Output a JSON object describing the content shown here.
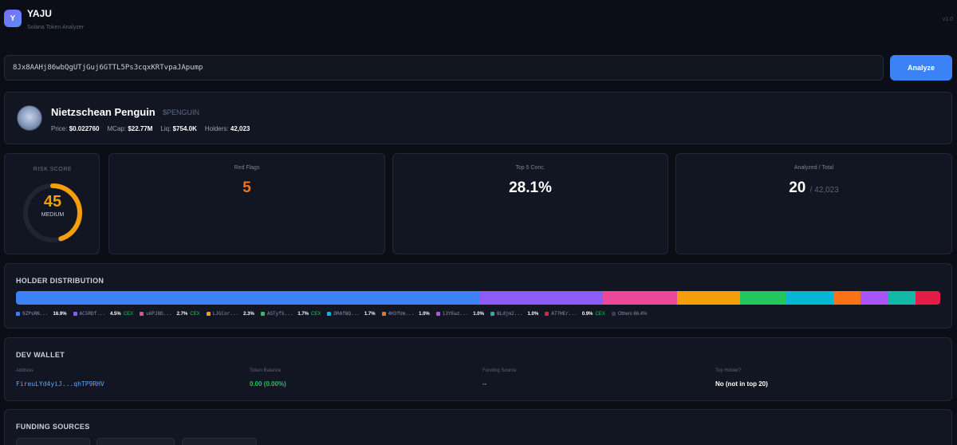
{
  "app": {
    "logo_letter": "Y",
    "title": "YAJU",
    "subtitle": "Solana Token Analyzer",
    "version": "v1.0"
  },
  "search": {
    "value": "8Jx8AAHj86wbQgUTjGuj6GTTL5Ps3cqxKRTvpaJApump",
    "button_label": "Analyze"
  },
  "token": {
    "name": "Nietzschean Penguin",
    "symbol": "$PENGUIN",
    "price_label": "Price:",
    "price": "$0.022760",
    "mcap_label": "MCap:",
    "mcap": "$22.77M",
    "liq_label": "Liq:",
    "liq": "$754.0K",
    "holders_label": "Holders:",
    "holders": "42,023"
  },
  "risk": {
    "label": "RISK SCORE",
    "score": "45",
    "score_fraction": 0.45,
    "level": "MEDIUM",
    "color": "#f59e0b"
  },
  "stats": {
    "red_flags_label": "Red Flags",
    "red_flags": "5",
    "top5_label": "Top 5 Conc.",
    "top5": "28.1%",
    "analyzed_label": "Analyzed / Total",
    "analyzed": "20",
    "total": "/ 42,023"
  },
  "distribution": {
    "title": "HOLDER DISTRIBUTION",
    "holders": [
      {
        "name": "9ZPsRN...",
        "pct": "16.9%",
        "value": 16.9,
        "cex": "",
        "color": "#3b82f6"
      },
      {
        "name": "AC5RDf...",
        "pct": "4.5%",
        "value": 4.5,
        "cex": "CEX",
        "color": "#8b5cf6"
      },
      {
        "name": "u6PJ8D...",
        "pct": "2.7%",
        "value": 2.7,
        "cex": "CEX",
        "color": "#ec4899"
      },
      {
        "name": "LJGCor...",
        "pct": "2.3%",
        "value": 2.3,
        "cex": "",
        "color": "#f59e0b"
      },
      {
        "name": "ASTyfS...",
        "pct": "1.7%",
        "value": 1.7,
        "cex": "CEX",
        "color": "#22c55e"
      },
      {
        "name": "DRAfBQ...",
        "pct": "1.7%",
        "value": 1.7,
        "cex": "",
        "color": "#06b6d4"
      },
      {
        "name": "4H3fUm...",
        "pct": "1.0%",
        "value": 1.0,
        "cex": "",
        "color": "#f97316"
      },
      {
        "name": "13YEwz...",
        "pct": "1.0%",
        "value": 1.0,
        "cex": "",
        "color": "#a855f7"
      },
      {
        "name": "BLdjm2...",
        "pct": "1.0%",
        "value": 1.0,
        "cex": "",
        "color": "#14b8a6"
      },
      {
        "name": "A77HEr...",
        "pct": "0.9%",
        "value": 0.9,
        "cex": "CEX",
        "color": "#e11d48"
      }
    ],
    "others_label": "Others 66.4%",
    "others_color": "#374151"
  },
  "dev_wallet": {
    "title": "DEV WALLET",
    "address_label": "Address",
    "address": "FireuLYd4yiJ...qhTP9RHV",
    "balance_label": "Token Balance",
    "balance": "0.00 (0.00%)",
    "funding_label": "Funding Source",
    "funding": "--",
    "top_holder_label": "Top Holder?",
    "top_holder": "No (not in top 20)"
  },
  "funding": {
    "title": "FUNDING SOURCES"
  }
}
